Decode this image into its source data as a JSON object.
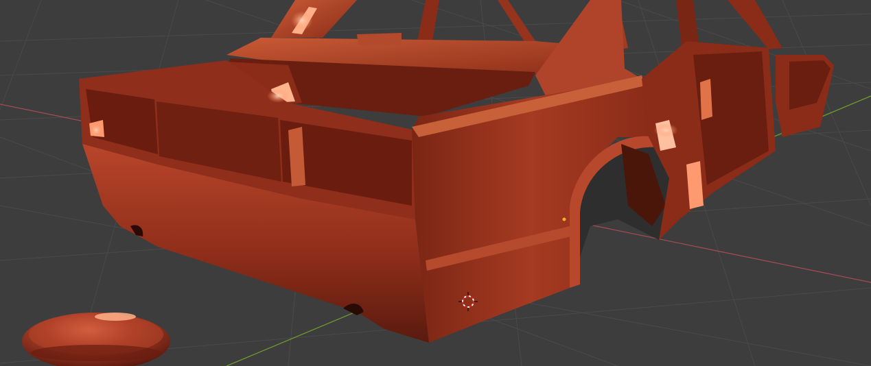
{
  "viewport": {
    "background": "#3d3d3d",
    "grid_color": "#4a4a4a",
    "x_axis_color": "#a34b56",
    "y_axis_color": "#6f9a2e"
  },
  "model": {
    "material_color": "#a83a22",
    "highlight_color": "#ff9a70",
    "shadow_color": "#4a140a"
  },
  "cursor": {
    "icon": "3d-cursor-icon",
    "ring_color": "#d02828"
  },
  "origin": {
    "icon": "object-origin-icon",
    "color": "#f0b030"
  }
}
